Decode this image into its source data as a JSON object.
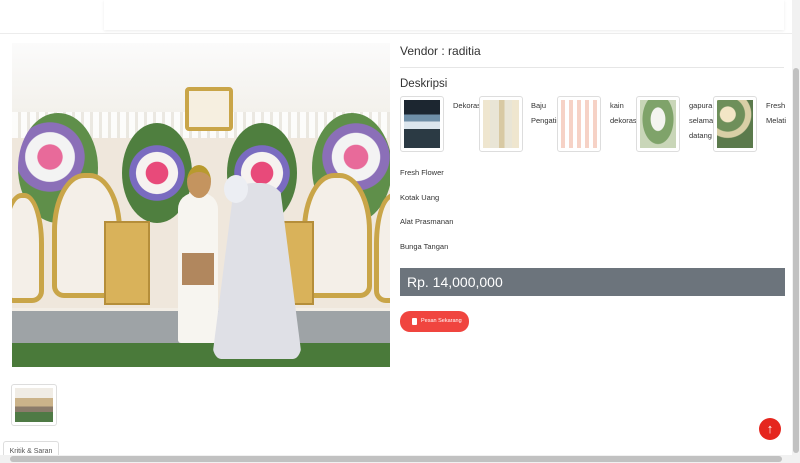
{
  "vendor": {
    "text": "Vendor : raditia"
  },
  "description": {
    "title": "Deskripsi",
    "items": [
      {
        "label": "Dekorasi",
        "icon": "dekorasi-photo"
      },
      {
        "label": "Baju Pengatin",
        "icon": "baju-photo"
      },
      {
        "label": "kain dekorasi",
        "icon": "kain-photo"
      },
      {
        "label": "gapura selamat datang",
        "icon": "gapura-photo"
      },
      {
        "label": "Fresh Melati",
        "icon": "melati-photo"
      }
    ],
    "list": [
      "Fresh Flower",
      "Kotak Uang",
      "Alat Prasmanan",
      "Bunga Tangan"
    ]
  },
  "price": "Rp. 14,000,000",
  "order_button": {
    "label": "Pesan Sekarang",
    "icon": "document-icon"
  },
  "tabs": {
    "review": "Kritik & Saran"
  },
  "scroll_top": {
    "icon": "arrow-up-icon",
    "glyph": "↑"
  },
  "colors": {
    "accent": "#f0453f",
    "price_bar": "#6c747c",
    "scroll_top": "#e5261e"
  }
}
